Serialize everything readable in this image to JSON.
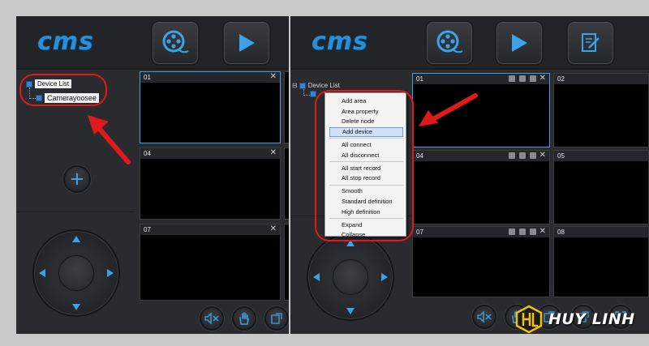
{
  "left": {
    "logo": "cms",
    "tree": {
      "root": "Device List",
      "child": "Camerayoosee"
    },
    "tiles": [
      "01",
      "04",
      "07"
    ]
  },
  "right": {
    "logo": "cms",
    "tree": {
      "root": "Device List"
    },
    "tiles": [
      "01",
      "02",
      "04",
      "05",
      "07",
      "08"
    ],
    "context_menu": {
      "groups": [
        [
          "Add area",
          "Area property",
          "Delete node",
          "Add device"
        ],
        [
          "All connect",
          "All disconnect"
        ],
        [
          "All start record",
          "All stop record"
        ],
        [
          "Smooth",
          "Standard definition",
          "High definition"
        ],
        [
          "Expand",
          "Collapse"
        ]
      ],
      "highlighted": "Add device"
    }
  },
  "colors": {
    "accent": "#2a8fd6",
    "annotation": "#e0191b",
    "selection": "#3da0e0"
  },
  "icons": [
    "film-reel-icon",
    "play-icon",
    "edit-document-icon",
    "add-icon",
    "mute-icon",
    "hand-icon",
    "exit-icon",
    "fullscreen-icon"
  ],
  "brand": {
    "name": "HUY LINH"
  }
}
